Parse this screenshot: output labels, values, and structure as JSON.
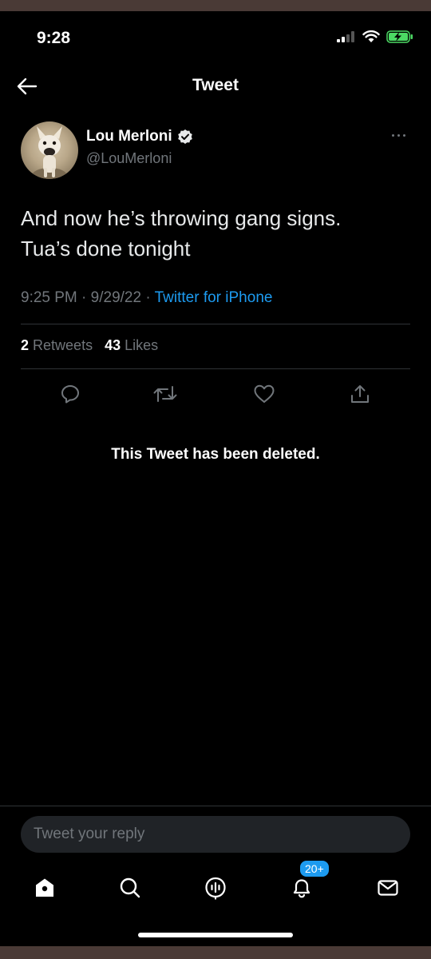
{
  "status_bar": {
    "time": "9:28",
    "battery_color": "#4cd964"
  },
  "nav": {
    "title": "Tweet"
  },
  "tweet": {
    "author_name": "Lou Merloni",
    "author_handle": "@LouMerloni",
    "text_line1": "And now he’s throwing gang signs.",
    "text_line2": "Tua’s done tonight",
    "time": "9:25 PM",
    "separator": "·",
    "date": "9/29/22",
    "source": "Twitter for iPhone",
    "retweets_count": "2",
    "retweets_label": "Retweets",
    "likes_count": "43",
    "likes_label": "Likes"
  },
  "deleted_notice": "This Tweet has been deleted.",
  "reply": {
    "placeholder": "Tweet your reply"
  },
  "tabbar": {
    "notifications_badge": "20+"
  },
  "colors": {
    "accent": "#1d9bf0",
    "muted": "#71767b",
    "background": "#000000"
  }
}
